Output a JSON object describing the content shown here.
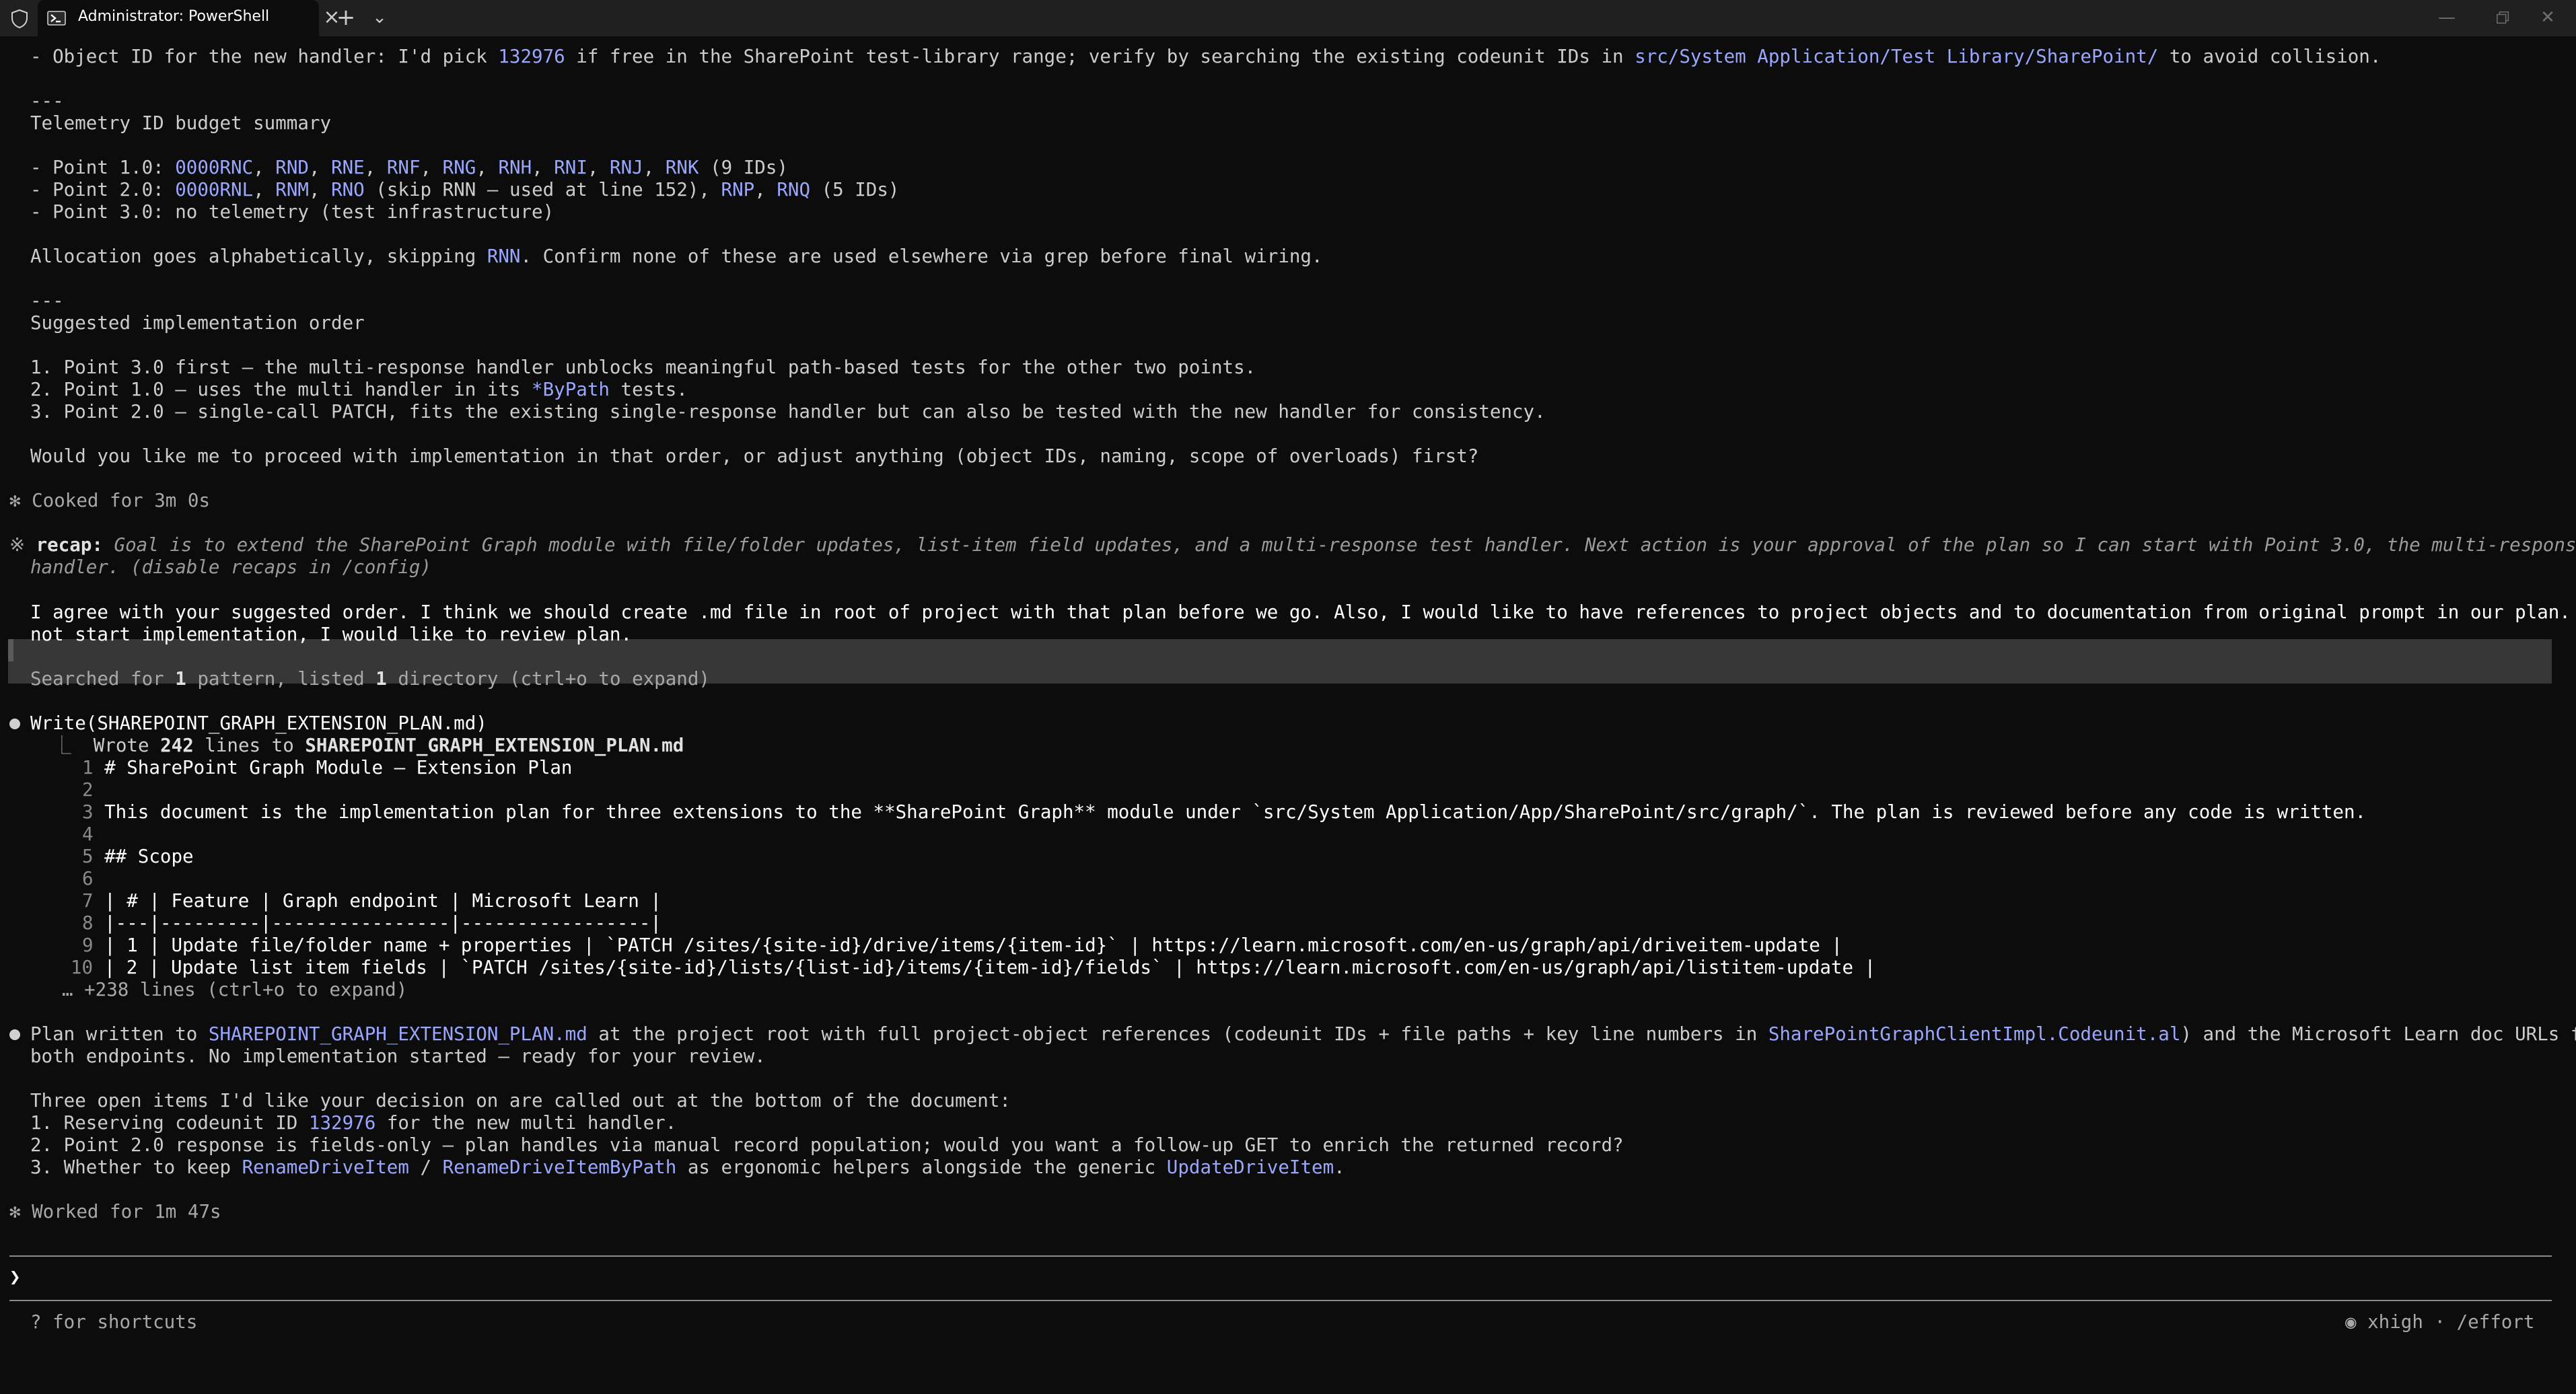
{
  "window": {
    "tab_title": "Administrator: PowerShell",
    "new_tab": "+",
    "close": "×"
  },
  "lines": {
    "l01a": "- Object ID for the new handler: I'd pick ",
    "l01b": "132976",
    "l01c": " if free in the SharePoint test-library range; verify by searching the existing codeunit IDs in ",
    "l01d": "src/System Application/Test Library/SharePoint/",
    "l01e": " to avoid collision.",
    "l02": "---",
    "l03": "Telemetry ID budget summary",
    "l04a": "- Point 1.0: ",
    "l04b": "0000RNC",
    "l04c": ", ",
    "l04d": "RND",
    "l04e": "RNE",
    "l04f": "RNF",
    "l04g": "RNG",
    "l04h": "RNH",
    "l04i": "RNI",
    "l04j": "RNJ",
    "l04k": "RNK",
    "l04l": " (9 IDs)",
    "l05a": "- Point 2.0: ",
    "l05b": "0000RNL",
    "l05c": "RNM",
    "l05d": "RNO",
    "l05e": " (skip RNN — used at line 152), ",
    "l05f": "RNP",
    "l05g": "RNQ",
    "l05h": " (5 IDs)",
    "l06": "- Point 3.0: no telemetry (test infrastructure)",
    "l07a": "Allocation goes alphabetically, skipping ",
    "l07b": "RNN",
    "l07c": ". Confirm none of these are used elsewhere via grep before final wiring.",
    "l08": "---",
    "l09": "Suggested implementation order",
    "l10": "1. Point 3.0 first — the multi-response handler unblocks meaningful path-based tests for the other two points.",
    "l11a": "2. Point 1.0 — uses the multi handler in its ",
    "l11b": "*ByPath",
    "l11c": " tests.",
    "l12": "3. Point 2.0 — single-call PATCH, fits the existing single-response handler but can also be tested with the new handler for consistency.",
    "l13": "Would you like me to proceed with implementation in that order, or adjust anything (object IDs, naming, scope of overloads) first?",
    "l14a": "✻",
    "l14b": " Cooked for 3m 0s",
    "l15a": "※",
    "l15b": " recap:",
    "l15c": " Goal is to extend the SharePoint Graph module with file/folder updates, list-item field updates, and a multi-response test handler. Next action is your approval of the plan so I can start with Point 3.0, the multi-response",
    "l16": "handler. (disable recaps in /config)",
    "l17": "I agree with your suggested order. I think we should create .md file in root of project with that plan before we go. Also, I would like to have references to project objects and to documentation from original prompt in our plan. Do",
    "l18": "not start implementation, I would like to review plan.",
    "l19a": "Searched for ",
    "l19b": "1",
    "l19c": " pattern, listed ",
    "l19d": "1",
    "l19e": " directory (ctrl+o to expand)",
    "l20": "Write(SHAREPOINT_GRAPH_EXTENSION_PLAN.md)",
    "l21a": "  ⎿  ",
    "l21b": "Wrote ",
    "l21c": "242",
    "l21d": " lines to ",
    "l21e": "SHAREPOINT_GRAPH_EXTENSION_PLAN.md",
    "f1n": "1",
    "f1": "# SharePoint Graph Module — Extension Plan",
    "f2n": "2",
    "f3n": "3",
    "f3": "This document is the implementation plan for three extensions to the **SharePoint Graph** module under `src/System Application/App/SharePoint/src/graph/`. The plan is reviewed before any code is written.",
    "f4n": "4",
    "f5n": "5",
    "f5": "## Scope",
    "f6n": "6",
    "f7n": "7",
    "f7": "| # | Feature | Graph endpoint | Microsoft Learn |",
    "f8n": "8",
    "f8": "|---|---------|----------------|-----------------|",
    "f9n": "9",
    "f9": "| 1 | Update file/folder name + properties | `PATCH /sites/{site-id}/drive/items/{item-id}` | https://learn.microsoft.com/en-us/graph/api/driveitem-update |",
    "f10n": "10",
    "f10": "| 2 | Update list item fields | `PATCH /sites/{site-id}/lists/{list-id}/items/{item-id}/fields` | https://learn.microsoft.com/en-us/graph/api/listitem-update |",
    "fmore": "… +238 lines (ctrl+o to expand)",
    "l32a": "Plan written to ",
    "l32b": "SHAREPOINT_GRAPH_EXTENSION_PLAN.md",
    "l32c": " at the project root with full project-object references (codeunit IDs + file paths + key line numbers in ",
    "l32d": "SharePointGraphClientImpl.Codeunit.al",
    "l32e": ") and the Microsoft Learn doc URLs for",
    "l33": "both endpoints. No implementation started — ready for your review.",
    "l34": "Three open items I'd like your decision on are called out at the bottom of the document:",
    "l35a": "1. Reserving codeunit ID ",
    "l35b": "132976",
    "l35c": " for the new multi handler.",
    "l36": "2. Point 2.0 response is fields-only — plan handles via manual record population; would you want a follow-up GET to enrich the returned record?",
    "l37a": "3. Whether to keep ",
    "l37b": "RenameDriveItem",
    "l37c": " / ",
    "l37d": "RenameDriveItemByPath",
    "l37e": " as ergonomic helpers alongside the generic ",
    "l37f": "UpdateDriveItem",
    "l37g": ".",
    "l38a": "✻",
    "l38b": " Worked for 1m 47s",
    "prompt": "❯",
    "shortcuts": "? for shortcuts",
    "effort": "◉ xhigh · /effort"
  }
}
